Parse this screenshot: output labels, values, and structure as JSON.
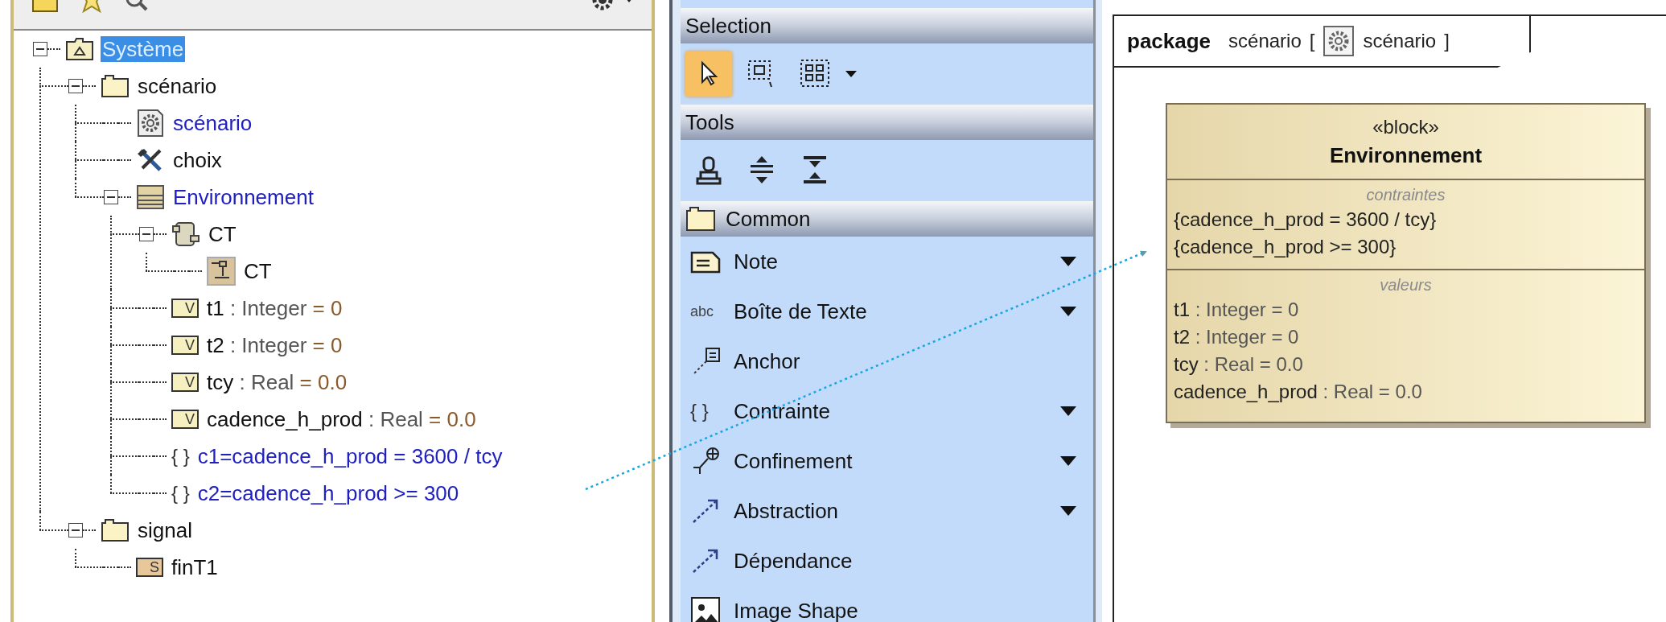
{
  "tree": {
    "items": [
      {
        "label": "Système",
        "kind": "model",
        "selected": true,
        "expanded": true,
        "children": [
          {
            "label": "scénario",
            "kind": "package",
            "selected": false,
            "expanded": true,
            "children": [
              {
                "label": "scénario",
                "kind": "diagram",
                "selected": false
              },
              {
                "label": "choix",
                "kind": "tool",
                "selected": false
              },
              {
                "label": "Environnement",
                "kind": "block",
                "selected": false,
                "expanded": true,
                "children": [
                  {
                    "label": "CT",
                    "kind": "part",
                    "selected": false,
                    "expanded": true,
                    "children": [
                      {
                        "label": "CT",
                        "kind": "part-type",
                        "selected": false
                      }
                    ]
                  },
                  {
                    "label": "t1",
                    "kind": "value",
                    "glyph": "V",
                    "type": " : Integer",
                    "default": " = 0",
                    "selected": false
                  },
                  {
                    "label": "t2",
                    "kind": "value",
                    "glyph": "V",
                    "type": " : Integer",
                    "default": " = 0",
                    "selected": false
                  },
                  {
                    "label": "tcy",
                    "kind": "value",
                    "glyph": "V",
                    "type": " : Real",
                    "default": " = 0.0",
                    "selected": false
                  },
                  {
                    "label": "cadence_h_prod",
                    "kind": "value",
                    "glyph": "V",
                    "type": " : Real",
                    "default": " = 0.0",
                    "selected": false
                  },
                  {
                    "label": "c1=cadence_h_prod = 3600 / tcy",
                    "kind": "constraint",
                    "glyph": "{ }",
                    "selected": false
                  },
                  {
                    "label": "c2=cadence_h_prod >= 300",
                    "kind": "constraint",
                    "glyph": "{ }",
                    "selected": false
                  }
                ]
              }
            ]
          },
          {
            "label": "signal",
            "kind": "package",
            "selected": false,
            "expanded": true,
            "children": [
              {
                "label": "finT1",
                "kind": "signal",
                "glyph": "S",
                "selected": false
              }
            ]
          }
        ]
      }
    ]
  },
  "palette": {
    "sections": [
      {
        "title": "Selection",
        "kind": "toolbar",
        "menu": true,
        "tools": [
          {
            "kind": "pointer",
            "selected": true
          },
          {
            "kind": "marquee",
            "selected": false
          },
          {
            "kind": "multi-marquee",
            "selected": false
          }
        ]
      },
      {
        "title": "Tools",
        "kind": "toolbar",
        "menu": false,
        "tools": [
          {
            "kind": "stamp",
            "selected": false
          },
          {
            "kind": "expand",
            "selected": false
          },
          {
            "kind": "collapse",
            "selected": false
          }
        ]
      },
      {
        "title": "Common",
        "kind": "list",
        "items": [
          {
            "label": "Note",
            "kind": "note",
            "menu": true
          },
          {
            "label": "Boîte de Texte",
            "kind": "text-box",
            "glyph": "abc",
            "menu": true
          },
          {
            "label": "Anchor",
            "kind": "anchor",
            "menu": false
          },
          {
            "label": "Contrainte",
            "kind": "constraint",
            "glyph": "{ }",
            "menu": true
          },
          {
            "label": "Confinement",
            "kind": "containment",
            "menu": true
          },
          {
            "label": "Abstraction",
            "kind": "abstraction",
            "menu": true
          },
          {
            "label": "Dépendance",
            "kind": "dependency",
            "menu": false
          },
          {
            "label": "Image Shape",
            "kind": "image",
            "menu": false
          }
        ]
      }
    ]
  },
  "diagram": {
    "frame": {
      "keyword": "package",
      "name": "scénario",
      "open": "[",
      "diagram_name": "scénario",
      "close": "]"
    },
    "block": {
      "stereotype": "«block»",
      "name": "Environnement",
      "compartments": [
        {
          "title": "contraintes",
          "lines": [
            {
              "text": "{cadence_h_prod = 3600 / tcy}"
            },
            {
              "text": "{cadence_h_prod >= 300}"
            }
          ]
        },
        {
          "title": "valeurs",
          "lines": [
            {
              "text": "t1",
              "rest": " : Integer = 0"
            },
            {
              "text": "t2",
              "rest": " : Integer = 0"
            },
            {
              "text": "tcy",
              "rest": " : Real = 0.0"
            },
            {
              "text": "cadence_h_prod",
              "rest": " : Real = 0.0"
            }
          ]
        }
      ]
    }
  }
}
